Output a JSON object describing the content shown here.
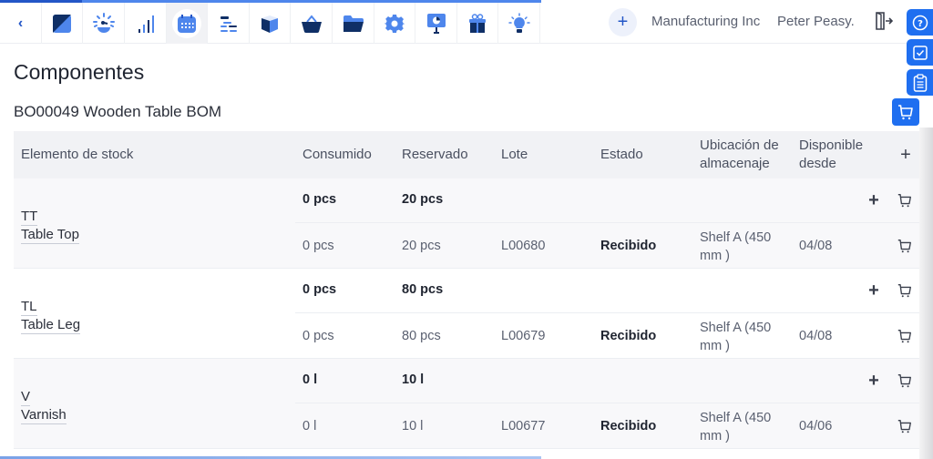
{
  "nav": {
    "back_label": "‹",
    "items": [
      {
        "name": "dashboard-icon"
      },
      {
        "name": "speedometer-icon"
      },
      {
        "name": "signal-bars-icon"
      },
      {
        "name": "calendar-icon",
        "active": true
      },
      {
        "name": "gantt-icon"
      },
      {
        "name": "box-icon"
      },
      {
        "name": "basket-icon"
      },
      {
        "name": "folder-icon"
      },
      {
        "name": "gear-icon"
      },
      {
        "name": "presentation-icon"
      },
      {
        "name": "gift-icon"
      },
      {
        "name": "lightbulb-icon"
      }
    ]
  },
  "header": {
    "add_label": "+",
    "company": "Manufacturing Inc",
    "user": "Peter Peasy."
  },
  "colors": {
    "accent": "#1f6ff0",
    "nav_dark": "#0f2f66",
    "nav_light": "#4e86ec"
  },
  "page": {
    "title": "Componentes",
    "bom": "BO00049 Wooden Table BOM"
  },
  "table": {
    "headers": {
      "item": "Elemento de stock",
      "consumed": "Consumido",
      "reserved": "Reservado",
      "lot": "Lote",
      "status": "Estado",
      "location_1": "Ubicación de",
      "location_2": "almacenaje",
      "available_1": "Disponible",
      "available_2": "desde",
      "add": "+"
    },
    "groups": [
      {
        "code": "TT",
        "name": "Table Top",
        "total_consumed": "0 pcs",
        "total_reserved": "20 pcs",
        "lines": [
          {
            "consumed": "0 pcs",
            "reserved": "20 pcs",
            "lot": "L00680",
            "status": "Recibido",
            "location_1": "Shelf A (450",
            "location_2": "mm )",
            "available": "04/08"
          }
        ]
      },
      {
        "code": "TL",
        "name": "Table Leg",
        "total_consumed": "0 pcs",
        "total_reserved": "80 pcs",
        "lines": [
          {
            "consumed": "0 pcs",
            "reserved": "80 pcs",
            "lot": "L00679",
            "status": "Recibido",
            "location_1": "Shelf A (450",
            "location_2": "mm )",
            "available": "04/08"
          }
        ]
      },
      {
        "code": "V",
        "name": "Varnish",
        "total_consumed": "0 l",
        "total_reserved": "10 l",
        "lines": [
          {
            "consumed": "0 l",
            "reserved": "10 l",
            "lot": "L00677",
            "status": "Recibido",
            "location_1": "Shelf A (450",
            "location_2": "mm )",
            "available": "04/06"
          }
        ]
      }
    ]
  },
  "row_actions": {
    "add": "+"
  }
}
